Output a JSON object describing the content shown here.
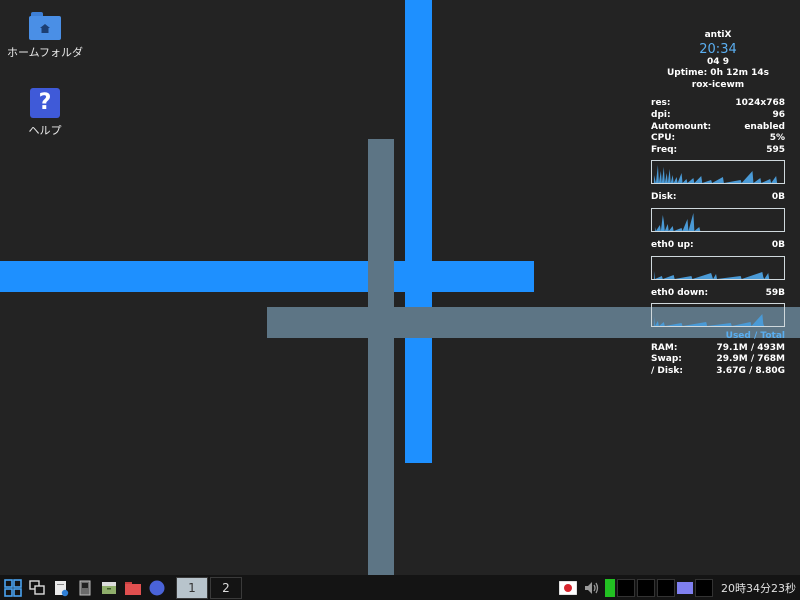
{
  "desktop": {
    "icons": [
      {
        "label": "ホームフォルダ",
        "icon": "home-folder-icon"
      },
      {
        "label": "ヘルプ",
        "icon": "help-icon",
        "glyph": "?"
      }
    ]
  },
  "conky": {
    "hostname": "antiX",
    "time": "20:34",
    "date": "04 9",
    "uptime": "Uptime: 0h 12m 14s",
    "wm": "rox-icewm",
    "stats": [
      {
        "label": "res:",
        "value": "1024x768"
      },
      {
        "label": "dpi:",
        "value": "96"
      },
      {
        "label": "Automount:",
        "value": "enabled"
      },
      {
        "label": "CPU:",
        "value": "5%"
      },
      {
        "label": "Freq:",
        "value": "595"
      }
    ],
    "disk": {
      "label": "Disk:",
      "value": "0B"
    },
    "eth0_up": {
      "label": "eth0 up:",
      "value": "0B"
    },
    "eth0_down": {
      "label": "eth0 down:",
      "value": "59B"
    },
    "usage_header": "Used / Total",
    "usage": [
      {
        "label": "RAM:",
        "value": "79.1M / 493M"
      },
      {
        "label": "Swap:",
        "value": "29.9M / 768M"
      },
      {
        "label": "/ Disk:",
        "value": "3.67G / 8.80G"
      }
    ],
    "colors": {
      "accent": "#5aaef0",
      "graph": "#4a9ad6"
    }
  },
  "taskbar": {
    "workspaces": [
      "1",
      "2"
    ],
    "active_workspace": "1",
    "clock": "20時34分23秒",
    "launchers": [
      "start-menu-icon",
      "window-list-icon",
      "file-manager-icon",
      "terminal-icon",
      "file-cabinet-icon",
      "folder-icon",
      "browser-icon"
    ],
    "tray": [
      "keyboard-layout-flag-icon",
      "volume-icon",
      "cpu-monitor-icon",
      "network-monitor-icon"
    ]
  }
}
